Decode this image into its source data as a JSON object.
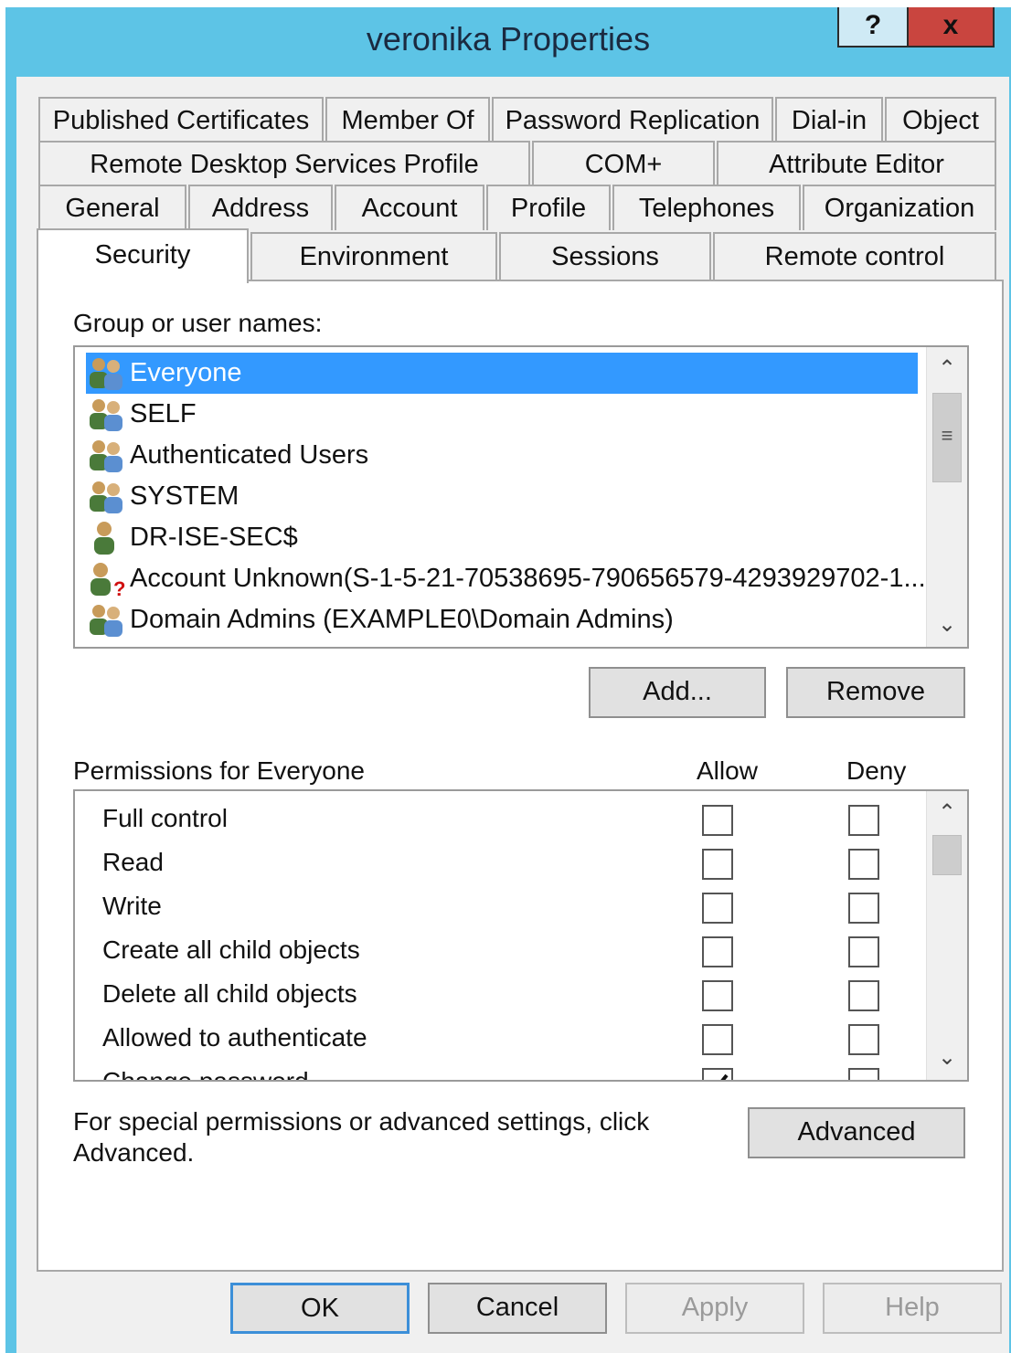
{
  "window": {
    "title": "veronika Properties",
    "help_label": "?",
    "close_label": "x"
  },
  "tabs": {
    "row1": [
      "Published Certificates",
      "Member Of",
      "Password Replication",
      "Dial-in",
      "Object"
    ],
    "row2": [
      "Remote Desktop Services Profile",
      "COM+",
      "Attribute Editor"
    ],
    "row3": [
      "General",
      "Address",
      "Account",
      "Profile",
      "Telephones",
      "Organization"
    ],
    "row4": [
      "Security",
      "Environment",
      "Sessions",
      "Remote control"
    ],
    "active": "Security"
  },
  "group": {
    "label": "Group or user names:",
    "users": [
      {
        "name": "Everyone",
        "icon": "group-users-icon",
        "selected": true
      },
      {
        "name": "SELF",
        "icon": "group-users-icon"
      },
      {
        "name": "Authenticated Users",
        "icon": "group-users-icon"
      },
      {
        "name": "SYSTEM",
        "icon": "group-users-icon"
      },
      {
        "name": "DR-ISE-SEC$",
        "icon": "single-user-icon"
      },
      {
        "name": "Account Unknown(S-1-5-21-70538695-790656579-4293929702-1...",
        "icon": "unknown-user-icon"
      },
      {
        "name": "Domain Admins (EXAMPLE0\\Domain Admins)",
        "icon": "group-users-icon"
      }
    ],
    "add_label": "Add...",
    "remove_label": "Remove"
  },
  "permissions": {
    "title": "Permissions for Everyone",
    "allow_header": "Allow",
    "deny_header": "Deny",
    "rows": [
      {
        "name": "Full control",
        "allow": false,
        "deny": false
      },
      {
        "name": "Read",
        "allow": false,
        "deny": false
      },
      {
        "name": "Write",
        "allow": false,
        "deny": false
      },
      {
        "name": "Create all child objects",
        "allow": false,
        "deny": false
      },
      {
        "name": "Delete all child objects",
        "allow": false,
        "deny": false
      },
      {
        "name": "Allowed to authenticate",
        "allow": false,
        "deny": false
      },
      {
        "name": "Change password",
        "allow": true,
        "deny": false
      }
    ]
  },
  "advanced": {
    "note_line1": "For special permissions or advanced settings, click",
    "note_line2": "Advanced.",
    "button_label": "Advanced"
  },
  "footer": {
    "ok_label": "OK",
    "cancel_label": "Cancel",
    "apply_label": "Apply",
    "help_label": "Help"
  },
  "colors": {
    "titlebar": "#5dc4e6",
    "selection": "#3399ff",
    "close": "#c9453f"
  }
}
